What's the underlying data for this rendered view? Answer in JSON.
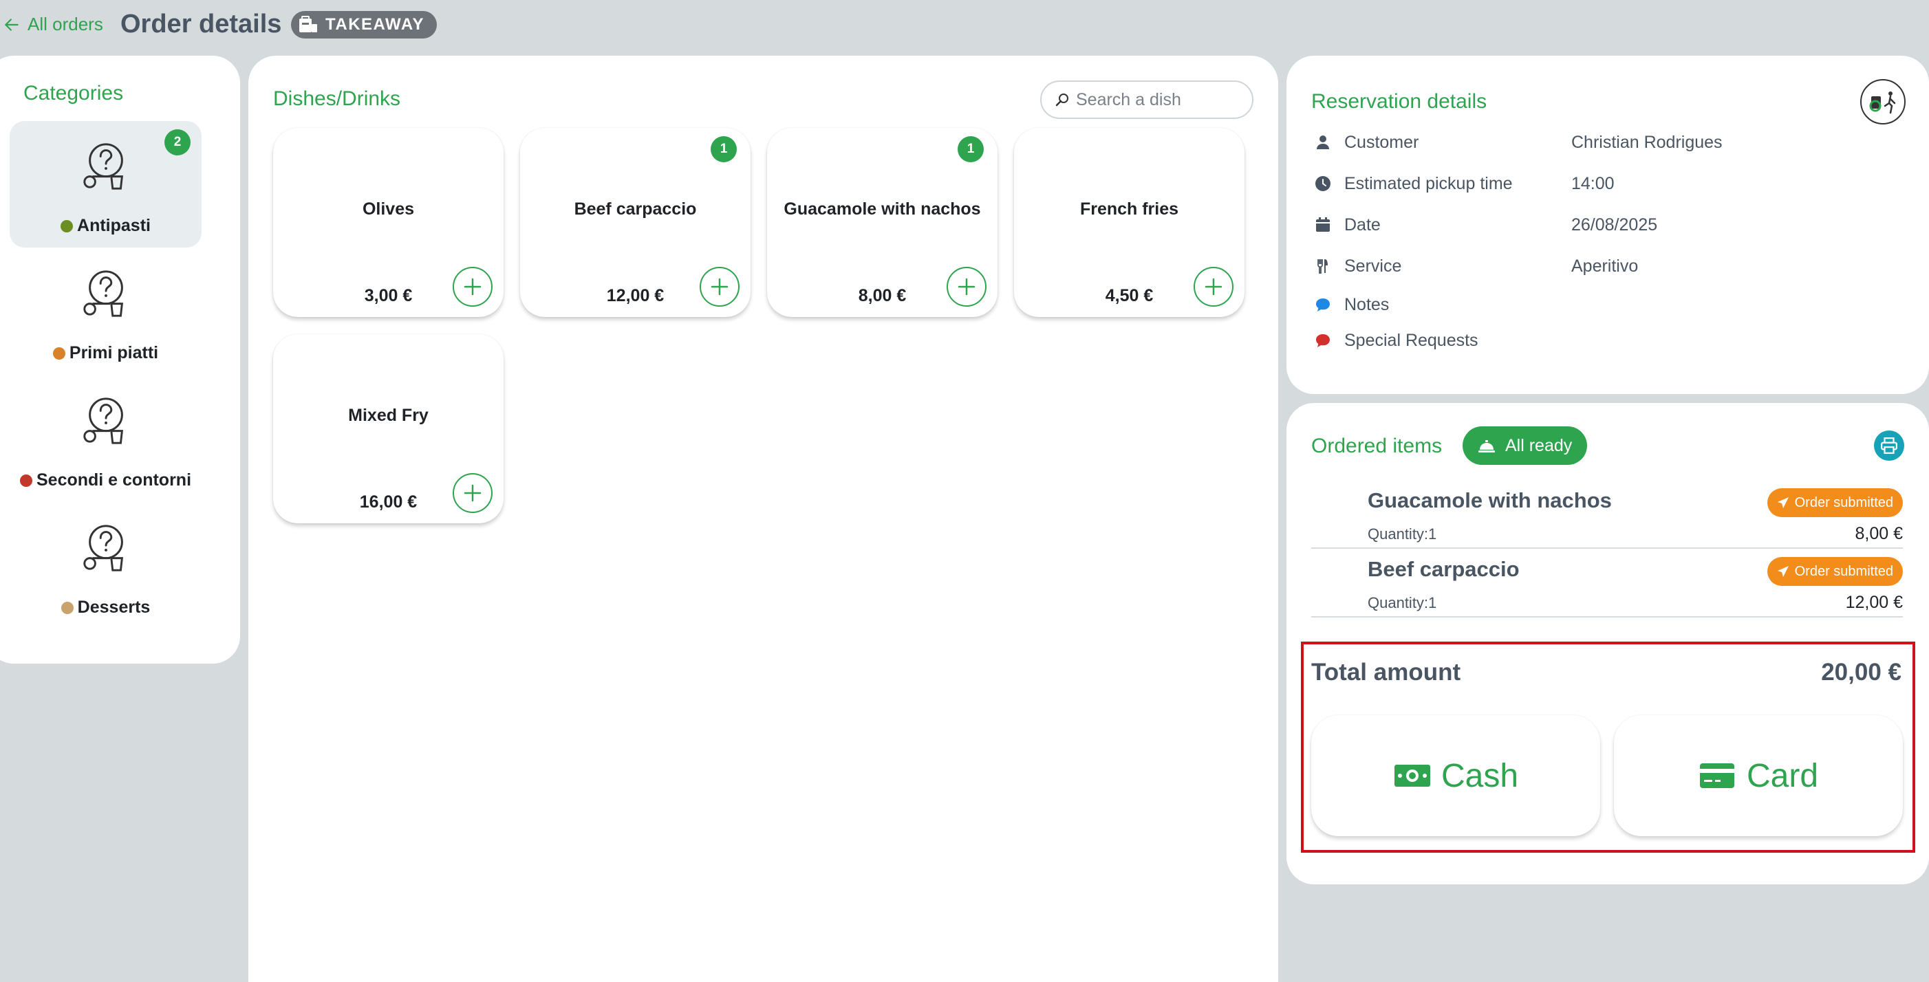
{
  "header": {
    "back_label": "All orders",
    "title": "Order details",
    "order_type": "TAKEAWAY"
  },
  "categories": {
    "title": "Categories",
    "items": [
      {
        "label": "Antipasti",
        "badge": "2",
        "active": true,
        "emoji_color": "#6b8e23"
      },
      {
        "label": "Primi piatti",
        "badge": "",
        "active": false,
        "emoji_color": "#d9822b"
      },
      {
        "label": "Secondi e contorni",
        "badge": "",
        "active": false,
        "emoji_color": "#c0392b"
      },
      {
        "label": "Desserts",
        "badge": "",
        "active": false,
        "emoji_color": "#c9a36b"
      }
    ]
  },
  "dishes": {
    "title": "Dishes/Drinks",
    "search_placeholder": "Search a dish",
    "items": [
      {
        "name": "Olives",
        "price": "3,00 €",
        "badge": ""
      },
      {
        "name": "Beef carpaccio",
        "price": "12,00 €",
        "badge": "1"
      },
      {
        "name": "Guacamole with nachos",
        "price": "8,00 €",
        "badge": "1"
      },
      {
        "name": "French fries",
        "price": "4,50 €",
        "badge": ""
      },
      {
        "name": "Mixed Fry",
        "price": "16,00 €",
        "badge": ""
      }
    ]
  },
  "reservation": {
    "title": "Reservation details",
    "rows": [
      {
        "icon": "person-icon",
        "label": "Customer",
        "value": "Christian Rodrigues"
      },
      {
        "icon": "clock-icon",
        "label": "Estimated pickup time",
        "value": "14:00"
      },
      {
        "icon": "calendar-icon",
        "label": "Date",
        "value": "26/08/2025"
      },
      {
        "icon": "utensils-icon",
        "label": "Service",
        "value": "Aperitivo"
      },
      {
        "icon": "notes-bubble-icon",
        "label": "Notes",
        "value": ""
      },
      {
        "icon": "special-requests-bubble-icon",
        "label": "Special Requests",
        "value": ""
      }
    ]
  },
  "ordered": {
    "title": "Ordered items",
    "all_ready_label": "All ready",
    "items": [
      {
        "name": "Guacamole with nachos",
        "quantity": "Quantity:1",
        "price": "8,00 €",
        "status": "Order submitted"
      },
      {
        "name": "Beef carpaccio",
        "quantity": "Quantity:1",
        "price": "12,00 €",
        "status": "Order submitted"
      }
    ],
    "total_label": "Total amount",
    "total_value": "20,00 €",
    "cash_label": "Cash",
    "card_label": "Card"
  },
  "colors": {
    "accent": "#2ea44f",
    "status_orange": "#f28c1a",
    "print_teal": "#17a2b8",
    "highlight_red": "#d0101d",
    "background": "#d5dadd"
  }
}
